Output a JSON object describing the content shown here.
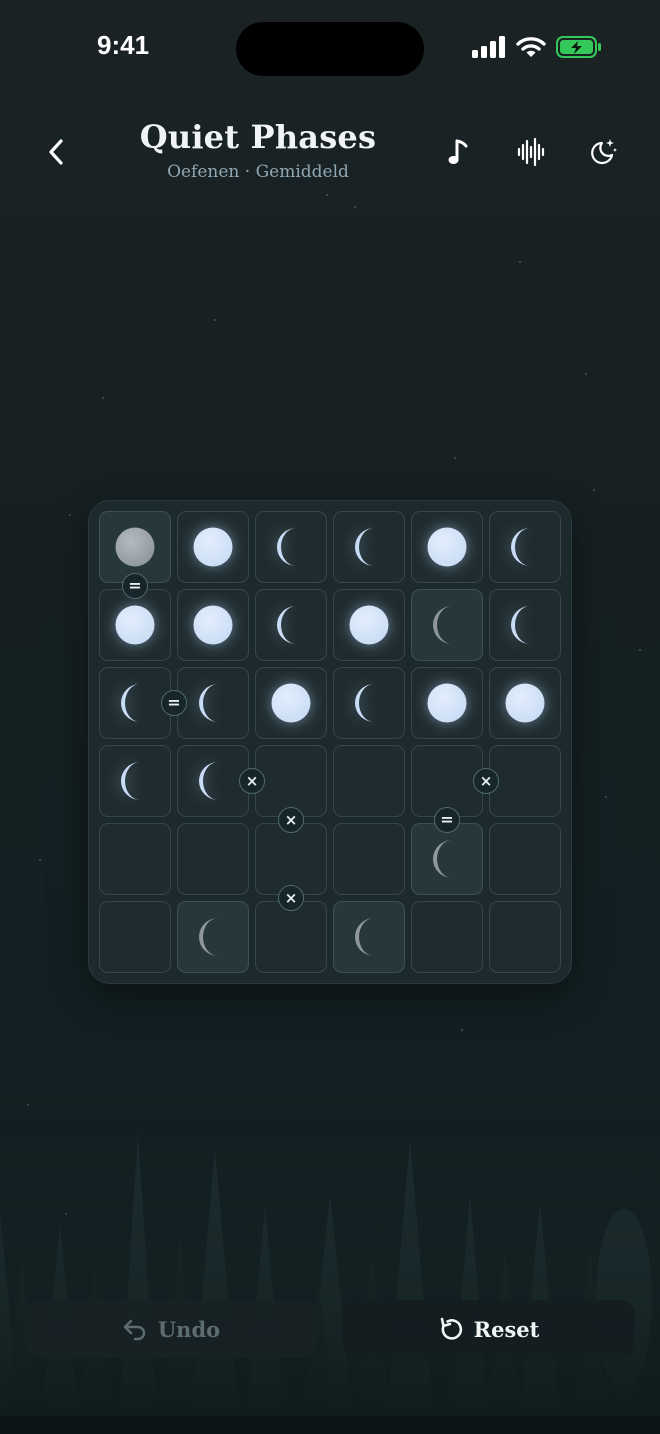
{
  "status_bar": {
    "time": "9:41"
  },
  "header": {
    "title": "Quiet Phases",
    "subtitle": "Oefenen · Gemiddeld"
  },
  "icons": {
    "back": "chevron-left-icon",
    "music": "music-note-icon",
    "sound": "waveform-icon",
    "theme": "moon-stars-icon"
  },
  "colors": {
    "moon_lit": "#c9dcf5",
    "moon_dim": "#8e979e",
    "background": "#162022",
    "accent_battery": "#34c759"
  },
  "board": {
    "size": 6,
    "rows": [
      [
        "full",
        "full",
        "crescent",
        "crescent",
        "full",
        "crescent"
      ],
      [
        "full",
        "full",
        "crescent",
        "full",
        "crescent",
        "crescent"
      ],
      [
        "crescent",
        "crescent",
        "full",
        "crescent",
        "full",
        "full"
      ],
      [
        "crescent",
        "crescent",
        "empty",
        "empty",
        "empty",
        "empty"
      ],
      [
        "empty",
        "empty",
        "empty",
        "empty",
        "crescent",
        "empty"
      ],
      [
        "empty",
        "crescent",
        "empty",
        "crescent",
        "empty",
        "empty"
      ]
    ],
    "locked": [
      [
        true,
        false,
        false,
        false,
        false,
        false
      ],
      [
        false,
        false,
        false,
        false,
        true,
        false
      ],
      [
        false,
        false,
        false,
        false,
        false,
        false
      ],
      [
        false,
        false,
        false,
        false,
        false,
        false
      ],
      [
        false,
        false,
        false,
        false,
        true,
        false
      ],
      [
        false,
        true,
        false,
        true,
        false,
        false
      ]
    ],
    "constraints": [
      {
        "type": "=",
        "symbol": "=",
        "between": [
          [
            0,
            0
          ],
          [
            1,
            0
          ]
        ]
      },
      {
        "type": "=",
        "symbol": "=",
        "between": [
          [
            2,
            0
          ],
          [
            2,
            1
          ]
        ]
      },
      {
        "type": "x",
        "symbol": "×",
        "between": [
          [
            3,
            1
          ],
          [
            3,
            2
          ]
        ]
      },
      {
        "type": "x",
        "symbol": "×",
        "between": [
          [
            3,
            2
          ],
          [
            4,
            2
          ]
        ]
      },
      {
        "type": "x",
        "symbol": "×",
        "between": [
          [
            4,
            2
          ],
          [
            5,
            2
          ]
        ]
      },
      {
        "type": "x",
        "symbol": "×",
        "between": [
          [
            3,
            4
          ],
          [
            3,
            5
          ]
        ]
      },
      {
        "type": "=",
        "symbol": "=",
        "between": [
          [
            3,
            4
          ],
          [
            4,
            4
          ]
        ]
      }
    ]
  },
  "buttons": {
    "undo_label": "Undo",
    "reset_label": "Reset"
  }
}
